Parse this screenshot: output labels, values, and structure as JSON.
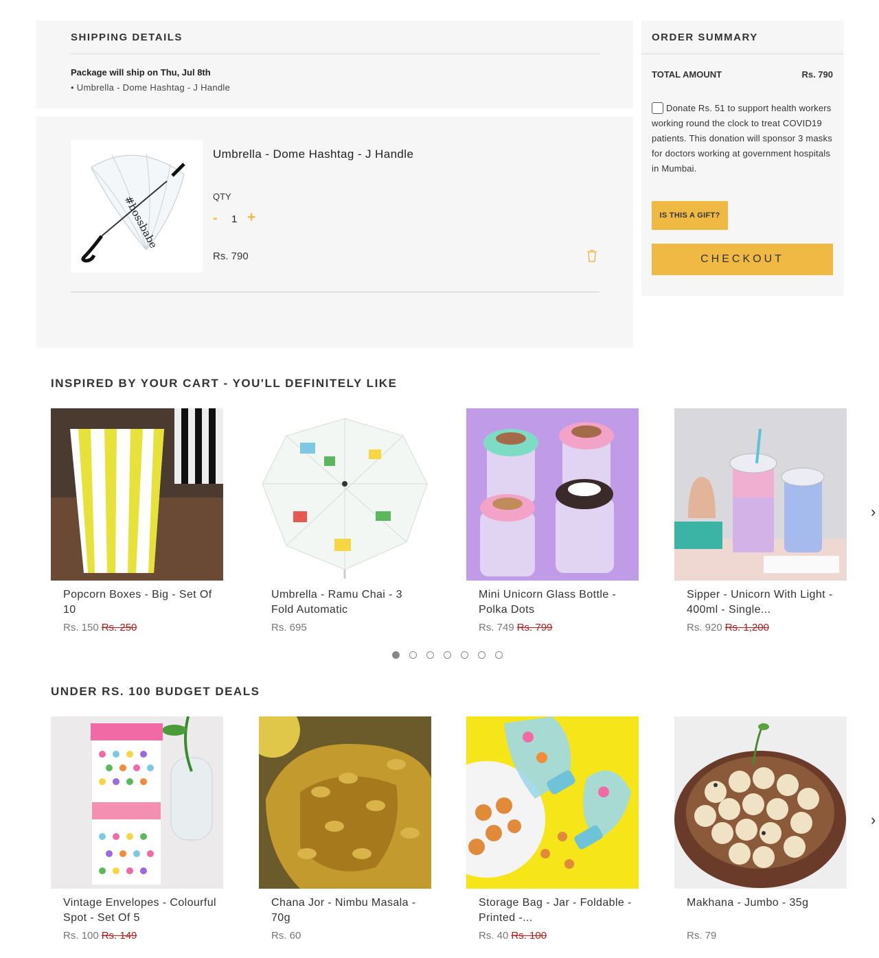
{
  "shipping": {
    "title": "SHIPPING DETAILS",
    "date_line": "Package will ship on Thu, Jul 8th",
    "item_line": "• Umbrella - Dome Hashtag - J Handle"
  },
  "cart": {
    "item_name": "Umbrella - Dome Hashtag - J Handle",
    "qty_label": "QTY",
    "minus": "-",
    "qty_value": "1",
    "plus": "+",
    "price": "Rs. 790",
    "image_text": "#bossbabe"
  },
  "summary": {
    "title": "ORDER SUMMARY",
    "total_label": "TOTAL AMOUNT",
    "total_value": "Rs. 790",
    "donate_text": "Donate Rs. 51 to support health workers working round the clock to treat COVID19 patients. This donation will sponsor 3 masks for doctors working at government hospitals in Mumbai.",
    "gift_label": "IS THIS A GIFT?",
    "checkout_label": "CHECKOUT"
  },
  "inspired": {
    "title": "INSPIRED BY YOUR CART - YOU'LL DEFINITELY LIKE",
    "products": [
      {
        "name": "Popcorn Boxes - Big - Set Of 10",
        "price": "Rs. 150",
        "old_price": "Rs. 250"
      },
      {
        "name": "Umbrella - Ramu Chai - 3 Fold Automatic",
        "price": "Rs. 695",
        "old_price": ""
      },
      {
        "name": "Mini Unicorn Glass Bottle - Polka Dots",
        "price": "Rs. 749",
        "old_price": "Rs. 799"
      },
      {
        "name": "Sipper - Unicorn With Light - 400ml - Single...",
        "price": "Rs. 920",
        "old_price": "Rs. 1,200"
      }
    ],
    "next": "›",
    "dots_active": 0,
    "dots_count": 7
  },
  "budget": {
    "title": "UNDER RS. 100 BUDGET DEALS",
    "products": [
      {
        "name": "Vintage Envelopes - Colourful Spot - Set Of 5",
        "price": "Rs. 100",
        "old_price": "Rs. 149"
      },
      {
        "name": "Chana Jor - Nimbu Masala - 70g",
        "price": "Rs. 60",
        "old_price": ""
      },
      {
        "name": "Storage Bag - Jar - Foldable - Printed -...",
        "price": "Rs. 40",
        "old_price": "Rs. 100"
      },
      {
        "name": "Makhana - Jumbo - 35g",
        "price": "Rs. 79",
        "old_price": ""
      }
    ],
    "next": "›"
  },
  "colors": {
    "accent": "#f0b944",
    "panel_bg": "#f6f6f6",
    "old_price": "#b71c1c"
  }
}
